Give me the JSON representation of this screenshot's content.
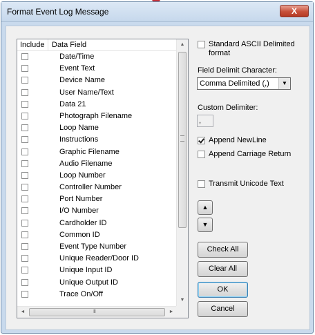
{
  "window": {
    "title": "Format Event Log Message",
    "close_label": "X"
  },
  "list": {
    "columns": [
      "Include",
      "Data Field"
    ],
    "rows": [
      {
        "label": "Date/Time",
        "checked": false
      },
      {
        "label": "Event Text",
        "checked": false
      },
      {
        "label": "Device Name",
        "checked": false
      },
      {
        "label": "User Name/Text",
        "checked": false
      },
      {
        "label": "Data 21",
        "checked": false
      },
      {
        "label": "Photograph Filename",
        "checked": false
      },
      {
        "label": "Loop Name",
        "checked": false
      },
      {
        "label": "Instructions",
        "checked": false
      },
      {
        "label": "Graphic Filename",
        "checked": false
      },
      {
        "label": "Audio Filename",
        "checked": false
      },
      {
        "label": "Loop Number",
        "checked": false
      },
      {
        "label": "Controller Number",
        "checked": false
      },
      {
        "label": "Port Number",
        "checked": false
      },
      {
        "label": "I/O Number",
        "checked": false
      },
      {
        "label": "Cardholder ID",
        "checked": false
      },
      {
        "label": "Common ID",
        "checked": false
      },
      {
        "label": "Event Type Number",
        "checked": false
      },
      {
        "label": "Unique Reader/Door ID",
        "checked": false
      },
      {
        "label": "Unique Input ID",
        "checked": false
      },
      {
        "label": "Unique Output ID",
        "checked": false
      },
      {
        "label": "Trace On/Off",
        "checked": false
      }
    ],
    "hscroll_grip": "III"
  },
  "options": {
    "standard_ascii_line1": "Standard ASCII Delimited",
    "standard_ascii_line2": "format",
    "standard_ascii_checked": false,
    "field_delimit_label": "Field Delimit Character:",
    "field_delimit_value": "Comma Delimited (,)",
    "custom_delimiter_label": "Custom Delimiter:",
    "custom_delimiter_value": ",",
    "append_newline_label": "Append NewLine",
    "append_newline_checked": true,
    "append_cr_label": "Append Carriage Return",
    "append_cr_checked": false,
    "transmit_unicode_label": "Transmit Unicode Text",
    "transmit_unicode_checked": false
  },
  "buttons": {
    "move_up": "▲",
    "move_down": "▼",
    "check_all": "Check All",
    "clear_all": "Clear All",
    "ok": "OK",
    "cancel": "Cancel"
  },
  "icons": {
    "scroll_up": "▲",
    "scroll_down": "▼",
    "scroll_left": "◄",
    "scroll_right": "►",
    "dropdown": "▼"
  }
}
